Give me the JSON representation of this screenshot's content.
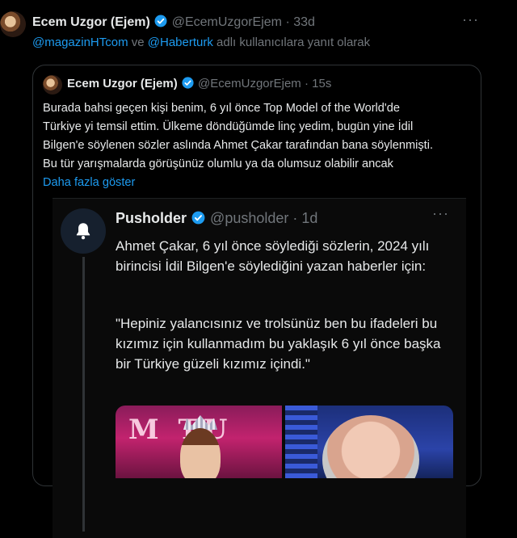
{
  "tweet": {
    "author_name": "Ecem Uzgor (Ejem)",
    "handle": "@EcemUzgorEjem",
    "separator": "·",
    "time": "33d",
    "more_icon": "more-dots-icon",
    "reply_context": {
      "mention_1": "@magazinHTcom",
      "connector": " ve ",
      "mention_2": "@Haberturk",
      "suffix": " adlı kullanıcılara yanıt olarak"
    }
  },
  "quote": {
    "author_name": "Ecem Uzgor (Ejem)",
    "handle": "@EcemUzgorEjem",
    "separator": "·",
    "time": "15s",
    "lines": [
      "Burada bahsi geçen kişi benim, 6 yıl önce Top Model of the World'de",
      "Türkiye yi temsil ettim. Ülkeme döndüğümde linç yedim, bugün yine İdil",
      "Bilgen'e söylenen sözler aslında Ahmet Çakar tarafından bana söylenmişti.",
      "Bu tür yarışmalarda görüşünüz olumlu ya da olumsuz olabilir ancak"
    ],
    "show_more": "Daha fazla göster"
  },
  "embedded": {
    "author_name": "Pusholder",
    "handle": "@pusholder",
    "separator": "·",
    "time": "1d",
    "avatar_icon": "bell-icon",
    "paragraph_1": "Ahmet Çakar, 6 yıl önce söylediği sözlerin, 2024 yılı birincisi İdil Bilgen'e söylediğini yazan haberler için:",
    "paragraph_2": "\"Hepiniz yalancısınız ve trolsünüz ben bu ifadeleri bu kızımız için kullanmadım bu yaklaşık 6 yıl önce başka bir Türkiye güzeli kızımız içindi.\"",
    "media_left_text": "M  TU"
  },
  "colors": {
    "background": "#000000",
    "text": "#e7e9ea",
    "muted": "#71767b",
    "link": "#1d9bf0",
    "verified": "#1d9bf0",
    "border": "#2f3336"
  }
}
